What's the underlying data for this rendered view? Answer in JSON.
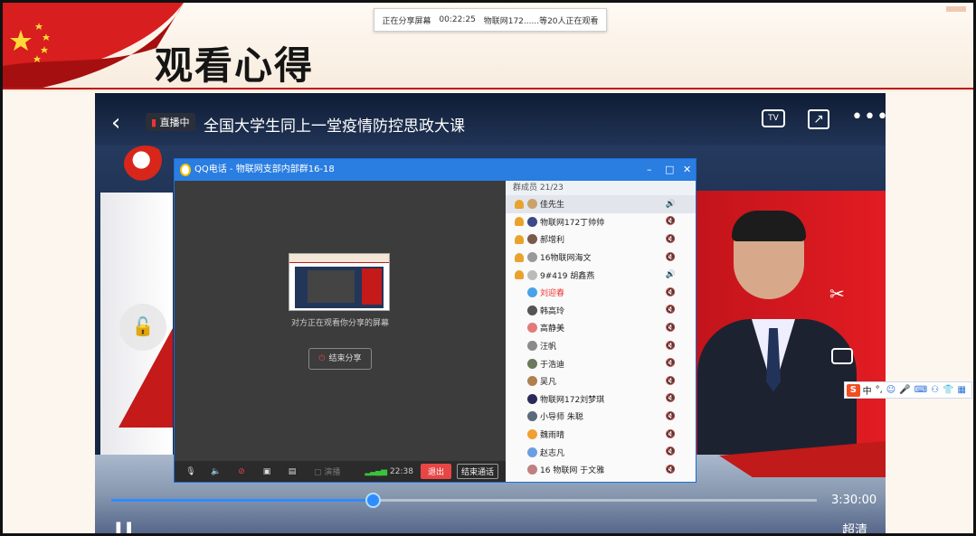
{
  "slide": {
    "title": "观看心得"
  },
  "share_bar": {
    "status": "正在分享屏幕",
    "duration": "00:22:25",
    "viewers": "物联网172......等20人正在观看"
  },
  "player": {
    "live_badge": "直播中",
    "title": "全国大学生同上一堂疫情防控思政大课",
    "tv_label": "TV",
    "total_time": "3:30:00",
    "quality": "超清",
    "progress": 0.37
  },
  "qq_window": {
    "title": "QQ电话 - 物联网支部内部群16-18",
    "minimize": "–",
    "maximize": "□",
    "close": "✕",
    "watch_text": "对方正在观看你分享的屏幕",
    "end_share": "结束分享",
    "present": "演播",
    "call_time": "22:38",
    "exit": "退出",
    "end_call": "结束通话",
    "member_count": "群成员 21/23",
    "members": [
      {
        "name": "佳先生",
        "admin": true,
        "speaking": true,
        "avatar_color": "#c9a36a"
      },
      {
        "name": "物联网172丁帅帅",
        "admin": true,
        "speaking": false,
        "avatar_color": "#3b4a86"
      },
      {
        "name": "郝增利",
        "admin": true,
        "speaking": false,
        "avatar_color": "#7a5a4a"
      },
      {
        "name": "16物联网海文",
        "admin": true,
        "speaking": false,
        "avatar_color": "#999999"
      },
      {
        "name": "9#419 胡鑫燕",
        "admin": true,
        "speaking": true,
        "avatar_color": "#bbbbbb"
      },
      {
        "name": "刘迎春",
        "admin": false,
        "speaking": false,
        "avatar_color": "#4aa3e8"
      },
      {
        "name": "韩高玲",
        "admin": false,
        "speaking": false,
        "avatar_color": "#555555"
      },
      {
        "name": "高静美",
        "admin": false,
        "speaking": false,
        "avatar_color": "#e27a7a"
      },
      {
        "name": "汪帆",
        "admin": false,
        "speaking": false,
        "avatar_color": "#8a8a8a"
      },
      {
        "name": "于浩迪",
        "admin": false,
        "speaking": false,
        "avatar_color": "#6a7a5a"
      },
      {
        "name": "吴凡",
        "admin": false,
        "speaking": false,
        "avatar_color": "#b08050"
      },
      {
        "name": "物联网172刘梦琪",
        "admin": false,
        "speaking": false,
        "avatar_color": "#2a2a5a"
      },
      {
        "name": "小导师 朱聪",
        "admin": false,
        "speaking": false,
        "avatar_color": "#5a6a7a"
      },
      {
        "name": "魏雨晴",
        "admin": false,
        "speaking": false,
        "avatar_color": "#f0a030"
      },
      {
        "name": "赵志凡",
        "admin": false,
        "speaking": false,
        "avatar_color": "#6aa0e0"
      },
      {
        "name": "16 物联网 于文雅",
        "admin": false,
        "speaking": false,
        "avatar_color": "#c08080"
      }
    ]
  },
  "ime": {
    "lang": "中",
    "punct": "°,"
  },
  "icons": {
    "back": "chevron-left-icon",
    "share": "share-icon",
    "more": "more-icon",
    "scissors": "scissors-icon",
    "camera": "camera-icon",
    "lock": "lock-icon"
  },
  "colors": {
    "accent_red": "#c01a1a",
    "qq_blue": "#2a7de1",
    "progress_blue": "#2f8cff"
  }
}
